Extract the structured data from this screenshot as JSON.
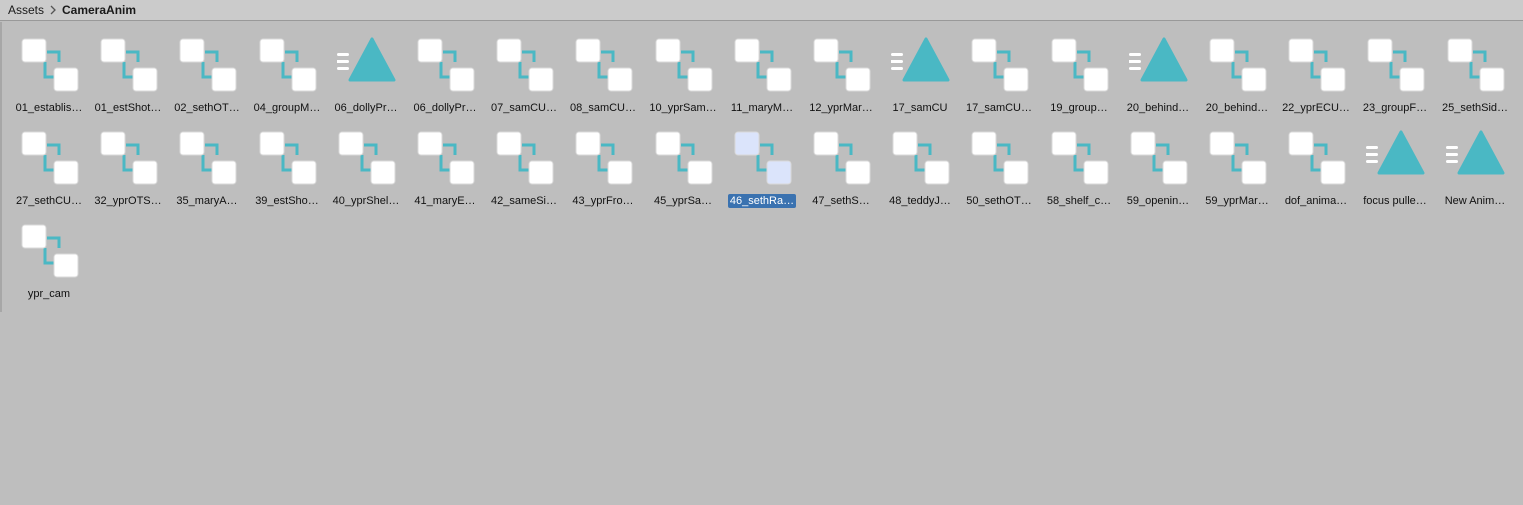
{
  "breadcrumb": {
    "root": "Assets",
    "current": "CameraAnim"
  },
  "icons": {
    "animator_controller": "animator-controller-icon",
    "animation_clip": "animation-clip-icon",
    "accent": "#4ab8c4"
  },
  "assets": [
    {
      "label": "01_establis…",
      "kind": "controller"
    },
    {
      "label": "01_estShot…",
      "kind": "controller"
    },
    {
      "label": "02_sethOT…",
      "kind": "controller"
    },
    {
      "label": "04_groupM…",
      "kind": "controller"
    },
    {
      "label": "06_dollyPr…",
      "kind": "clip"
    },
    {
      "label": "06_dollyPr…",
      "kind": "controller"
    },
    {
      "label": "07_samCU…",
      "kind": "controller"
    },
    {
      "label": "08_samCU…",
      "kind": "controller"
    },
    {
      "label": "10_yprSam…",
      "kind": "controller"
    },
    {
      "label": "11_maryM…",
      "kind": "controller"
    },
    {
      "label": "12_yprMar…",
      "kind": "controller"
    },
    {
      "label": "17_samCU",
      "kind": "clip"
    },
    {
      "label": "17_samCU…",
      "kind": "controller"
    },
    {
      "label": "19_group…",
      "kind": "controller"
    },
    {
      "label": "20_behind…",
      "kind": "clip"
    },
    {
      "label": "20_behind…",
      "kind": "controller"
    },
    {
      "label": "22_yprECU…",
      "kind": "controller"
    },
    {
      "label": "23_groupF…",
      "kind": "controller"
    },
    {
      "label": "25_sethSid…",
      "kind": "controller"
    },
    {
      "label": "27_sethCU…",
      "kind": "controller"
    },
    {
      "label": "32_yprOTS…",
      "kind": "controller"
    },
    {
      "label": "35_maryA…",
      "kind": "controller"
    },
    {
      "label": "39_estSho…",
      "kind": "controller"
    },
    {
      "label": "40_yprShel…",
      "kind": "controller"
    },
    {
      "label": "41_maryE…",
      "kind": "controller"
    },
    {
      "label": "42_sameSi…",
      "kind": "controller"
    },
    {
      "label": "43_yprFro…",
      "kind": "controller"
    },
    {
      "label": "45_yprSa…",
      "kind": "controller"
    },
    {
      "label": "46_sethRa…",
      "kind": "controller",
      "selected": true
    },
    {
      "label": "47_sethS…",
      "kind": "controller"
    },
    {
      "label": "48_teddyJ…",
      "kind": "controller"
    },
    {
      "label": "50_sethOT…",
      "kind": "controller"
    },
    {
      "label": "58_shelf_c…",
      "kind": "controller"
    },
    {
      "label": "59_openin…",
      "kind": "controller"
    },
    {
      "label": "59_yprMar…",
      "kind": "controller"
    },
    {
      "label": "dof_anima…",
      "kind": "controller"
    },
    {
      "label": "focus pulle…",
      "kind": "clip"
    },
    {
      "label": "New Anim…",
      "kind": "clip"
    },
    {
      "label": "ypr_cam",
      "kind": "controller"
    }
  ]
}
